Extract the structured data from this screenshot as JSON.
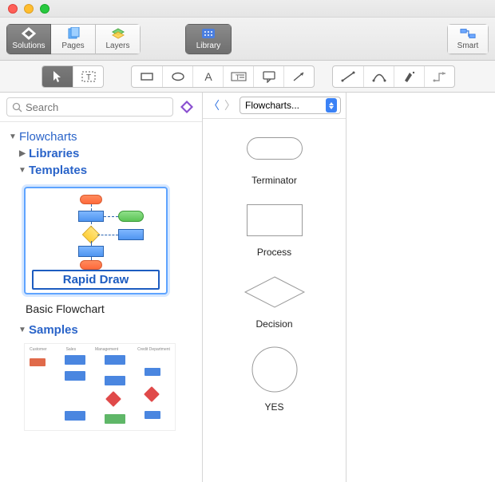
{
  "titlebar": {},
  "maintool": {
    "solutions": "Solutions",
    "pages": "Pages",
    "layers": "Layers",
    "library": "Library",
    "smart": "Smart"
  },
  "search": {
    "placeholder": "Search"
  },
  "tree": {
    "root": "Flowcharts",
    "libraries": "Libraries",
    "templates": "Templates",
    "samples": "Samples"
  },
  "thumb": {
    "rapid_draw": "Rapid Draw",
    "title": "Basic Flowchart"
  },
  "libpane": {
    "selector": "Flowcharts...",
    "shapes": [
      {
        "id": "terminator",
        "label": "Terminator"
      },
      {
        "id": "process",
        "label": "Process"
      },
      {
        "id": "decision",
        "label": "Decision"
      },
      {
        "id": "yes",
        "label": "YES"
      }
    ]
  }
}
